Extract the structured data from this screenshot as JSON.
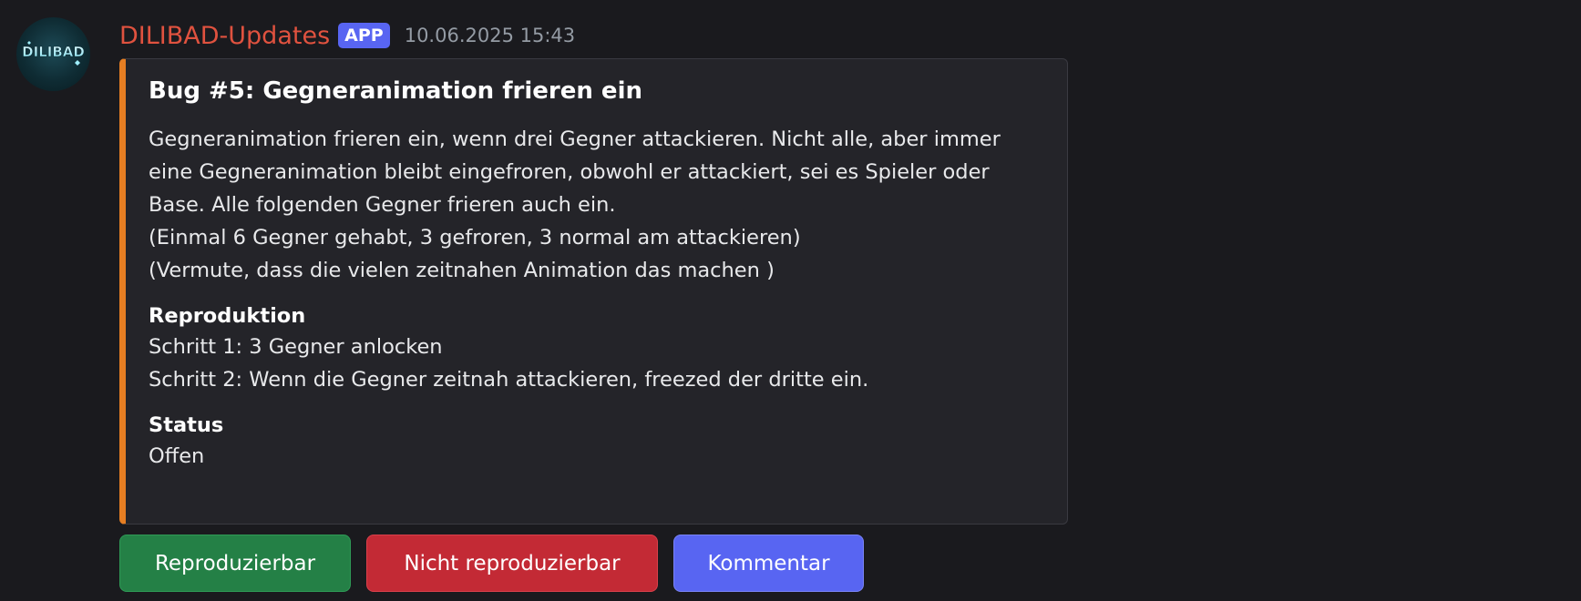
{
  "message": {
    "author": "DILIBAD-Updates",
    "badge": "APP",
    "timestamp": "10.06.2025 15:43",
    "avatar_text": "DILIBAD",
    "avatar_icon": "dilibad-logo-icon"
  },
  "embed": {
    "accent_color": "#e67e22",
    "title": "Bug #5: Gegneranimation frieren ein",
    "description_lines": [
      "Gegneranimation frieren ein, wenn drei Gegner attackieren. Nicht alle, aber immer",
      "eine Gegneranimation bleibt eingefroren, obwohl er attackiert, sei es Spieler oder",
      "Base. Alle folgenden Gegner frieren auch ein.",
      "(Einmal 6 Gegner gehabt, 3 gefroren, 3 normal am attackieren)",
      "(Vermute, dass die vielen zeitnahen Animation das machen )"
    ],
    "fields": [
      {
        "name": "Reproduktion",
        "value_lines": [
          "Schritt 1: 3 Gegner anlocken",
          "Schritt 2: Wenn die Gegner zeitnah attackieren, freezed der dritte ein."
        ]
      },
      {
        "name": "Status",
        "value_lines": [
          "Offen"
        ]
      }
    ]
  },
  "buttons": {
    "reproducible": {
      "label": "Reproduzierbar",
      "color": "#248046"
    },
    "not_reproducible": {
      "label": "Nicht reproduzierbar",
      "color": "#c32a35"
    },
    "comment": {
      "label": "Kommentar",
      "color": "#5865f2"
    }
  }
}
